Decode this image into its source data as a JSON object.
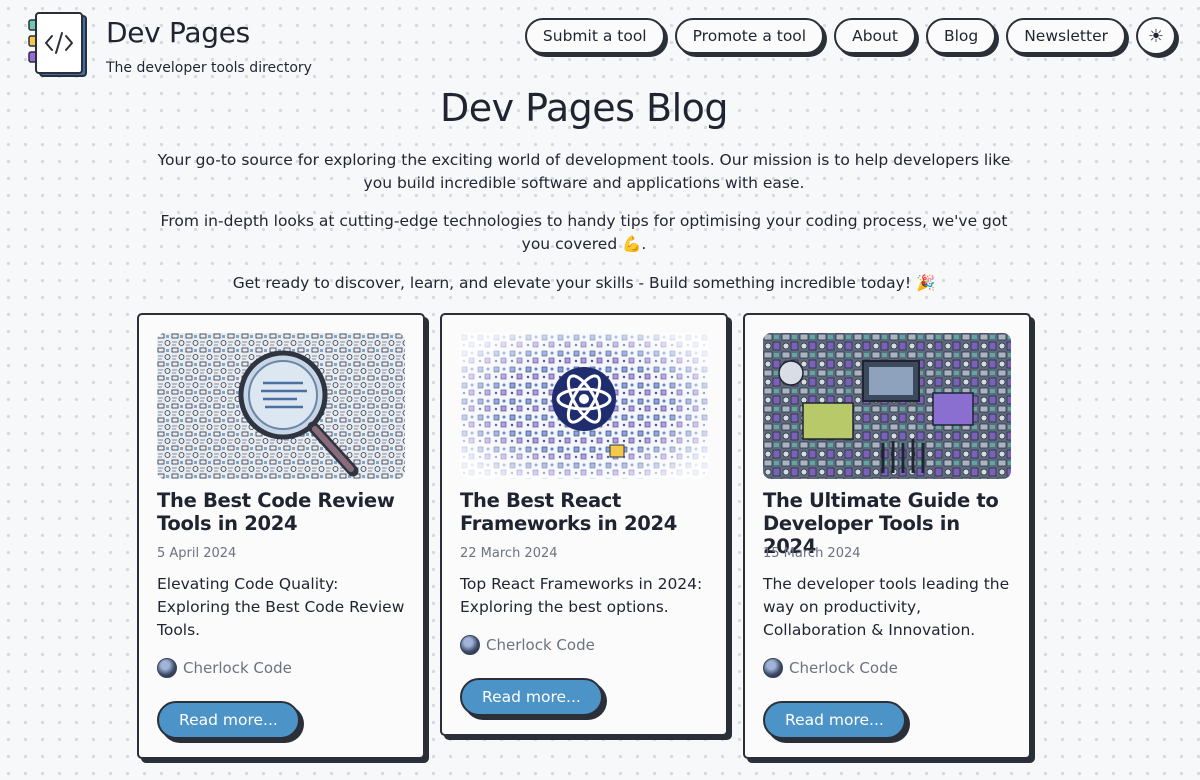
{
  "brand": {
    "title": "Dev Pages",
    "subtitle": "The developer tools directory",
    "logo_icon": "code-brackets-icon"
  },
  "nav": {
    "items": [
      "Submit a tool",
      "Promote a tool",
      "About",
      "Blog",
      "Newsletter"
    ],
    "theme_toggle": "☀",
    "theme_icon": "sun-icon"
  },
  "hero": {
    "title": "Dev Pages Blog",
    "intro_1": "Your go-to source for exploring the exciting world of development tools. Our mission is to help developers like you build incredible software and applications with ease.",
    "intro_2": "From in-depth looks at cutting-edge technologies to handy tips for optimising your coding process, we've got you covered 💪.",
    "intro_3": "Get ready to discover, learn, and elevate your skills - Build something incredible today! 🎉"
  },
  "posts": [
    {
      "title": "The Best Code Review Tools in 2024",
      "date": "5 April 2024",
      "description": "Elevating Code Quality: Exploring the Best Code Review Tools.",
      "author": "Cherlock Code",
      "cta": "Read more...",
      "image_icon": "magnifying-glass-illustration"
    },
    {
      "title": "The Best React Frameworks in 2024",
      "date": "22 March 2024",
      "description": "Top React Frameworks in 2024: Exploring the best options.",
      "author": "Cherlock Code",
      "cta": "Read more...",
      "image_icon": "react-atom-illustration"
    },
    {
      "title": "The Ultimate Guide to Developer Tools in 2024",
      "date": "15 March 2024",
      "description": "The developer tools leading the way on productivity, Collaboration & Innovation.",
      "author": "Cherlock Code",
      "cta": "Read more...",
      "image_icon": "developer-tools-collage-illustration"
    }
  ],
  "colors": {
    "accent_button": "#4c93c8",
    "border": "#2b2f38",
    "background": "#f7f8fa",
    "muted_text": "#6b7280"
  }
}
